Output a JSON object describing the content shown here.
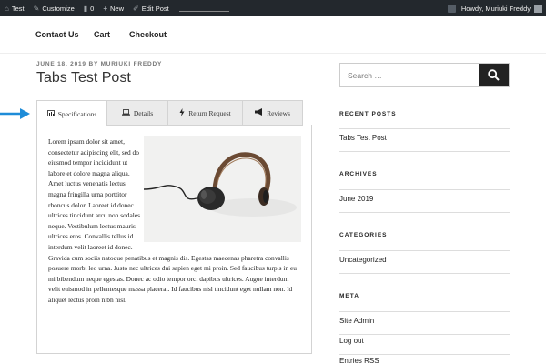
{
  "adminbar": {
    "site": "Test",
    "customize": "Customize",
    "comments": "0",
    "new": "New",
    "edit": "Edit Post",
    "howdy": "Howdy, Muriuki Freddy"
  },
  "nav": {
    "items": [
      {
        "label": "Contact Us"
      },
      {
        "label": "Cart"
      },
      {
        "label": "Checkout"
      }
    ]
  },
  "post": {
    "meta": "JUNE 18, 2019 BY MURIUKI FREDDY",
    "title": "Tabs Test Post",
    "tabs": [
      {
        "label": "Specifications",
        "icon": "chart-icon"
      },
      {
        "label": "Details",
        "icon": "laptop-icon"
      },
      {
        "label": "Return Request",
        "icon": "bolt-icon"
      },
      {
        "label": "Reviews",
        "icon": "megaphone-icon"
      }
    ],
    "body": "Lorem ipsum dolor sit amet, consectetur adipiscing elit, sed do eiusmod tempor incididunt ut labore et dolore magna aliqua. Amet luctus venenatis lectus magna fringilla urna porttitor rhoncus dolor. Laoreet id donec ultrices tincidunt arcu non sodales neque. Vestibulum lectus mauris ultrices eros. Convallis tellus id interdum velit laoreet id donec. Gravida cum sociis natoque penatibus et magnis dis. Egestas maecenas pharetra convallis posuere morbi leo urna. Justo nec ultrices dui sapien eget mi proin. Sed faucibus turpis in eu mi bibendum neque egestas. Donec ac odio tempor orci dapibus ultrices. Augue interdum velit euismod in pellentesque massa placerat. Id faucibus nisl tincidunt eget nullam non. Id aliquet lectus proin nibh nisl."
  },
  "sidebar": {
    "search_placeholder": "Search …",
    "recent_posts": {
      "heading": "RECENT POSTS",
      "items": [
        "Tabs Test Post"
      ]
    },
    "archives": {
      "heading": "ARCHIVES",
      "items": [
        "June 2019"
      ]
    },
    "categories": {
      "heading": "CATEGORIES",
      "items": [
        "Uncategorized"
      ]
    },
    "meta": {
      "heading": "META",
      "items": [
        "Site Admin",
        "Log out",
        "Entries RSS"
      ]
    }
  },
  "colors": {
    "adminbar_bg": "#23282d",
    "arrow": "#1e8cd8",
    "tab_inactive": "#ebebeb"
  }
}
